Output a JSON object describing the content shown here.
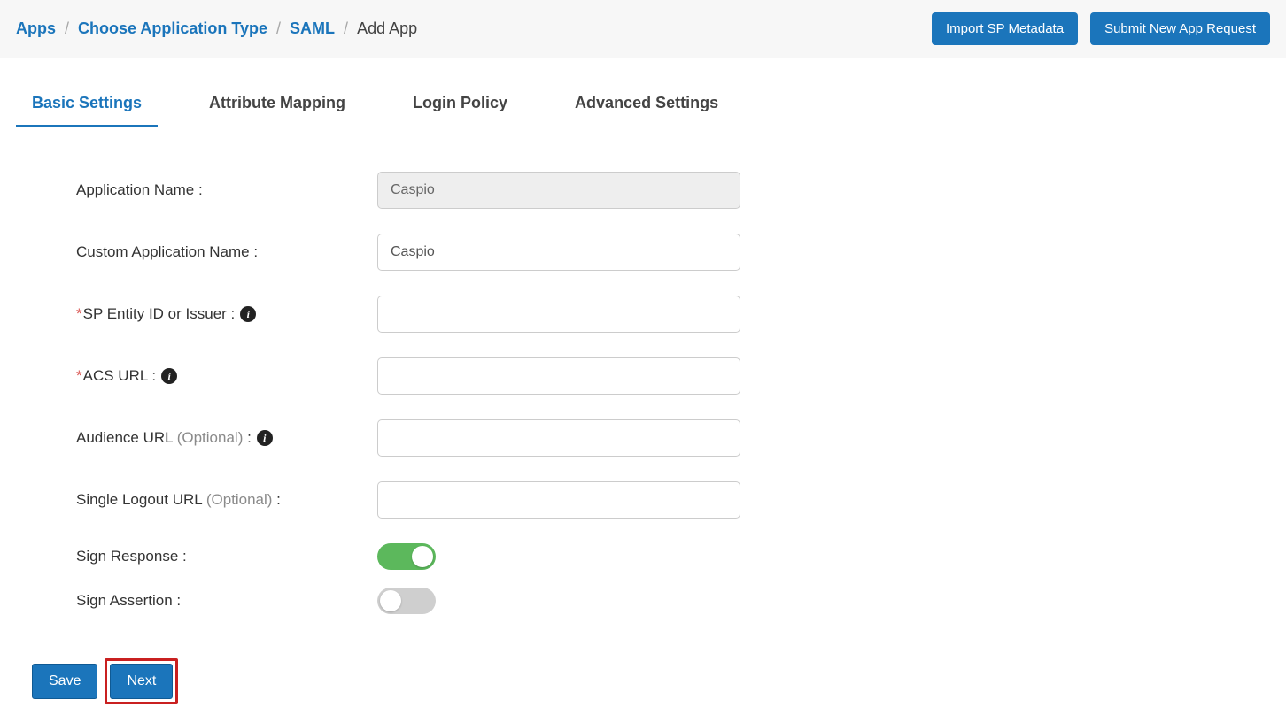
{
  "breadcrumb": {
    "items": [
      {
        "label": "Apps"
      },
      {
        "label": "Choose Application Type"
      },
      {
        "label": "SAML"
      }
    ],
    "current": "Add App",
    "separator": "/"
  },
  "topbar_actions": {
    "import_metadata": "Import SP Metadata",
    "submit_request": "Submit New App Request"
  },
  "tabs": [
    {
      "id": "basic",
      "label": "Basic Settings",
      "active": true
    },
    {
      "id": "attribute",
      "label": "Attribute Mapping",
      "active": false
    },
    {
      "id": "login",
      "label": "Login Policy",
      "active": false
    },
    {
      "id": "advanced",
      "label": "Advanced Settings",
      "active": false
    }
  ],
  "form": {
    "app_name": {
      "label": "Application Name :",
      "value": "Caspio"
    },
    "custom_name": {
      "label": "Custom Application Name :",
      "value": "Caspio"
    },
    "sp_entity": {
      "label": "SP Entity ID or Issuer :",
      "value": ""
    },
    "acs_url": {
      "label": "ACS URL :",
      "value": ""
    },
    "audience_url": {
      "label_main": "Audience URL ",
      "label_optional": "(Optional)",
      "label_suffix": " :",
      "value": ""
    },
    "slo_url": {
      "label_main": "Single Logout URL ",
      "label_optional": "(Optional)",
      "label_suffix": " :",
      "value": ""
    },
    "sign_response": {
      "label": "Sign Response :",
      "on": true
    },
    "sign_assertion": {
      "label": "Sign Assertion :",
      "on": false
    }
  },
  "footer": {
    "save": "Save",
    "next": "Next"
  },
  "icons": {
    "info_glyph": "i"
  }
}
